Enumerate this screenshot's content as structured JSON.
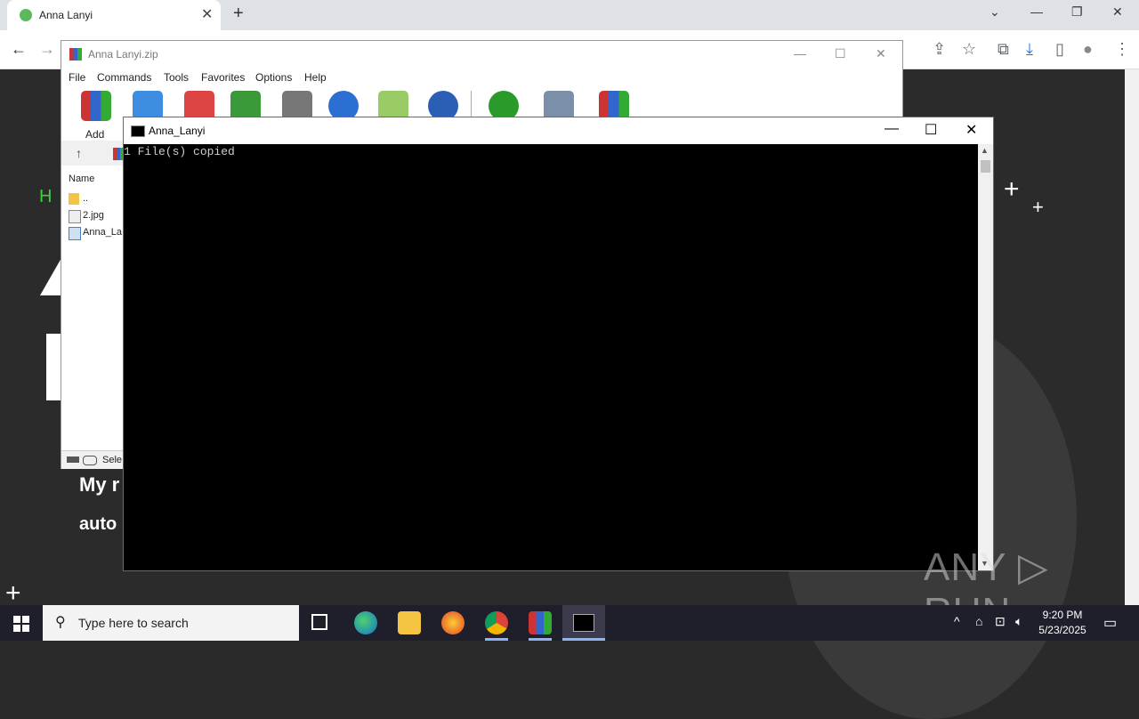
{
  "chrome": {
    "tab_title": "Anna Lanyi",
    "tab_close": "✕",
    "new_tab": "+",
    "window_controls": {
      "minimize": "—",
      "restore": "❐",
      "close": "✕"
    },
    "nav": {
      "back": "←",
      "forward": "→"
    },
    "toolbar_icons": {
      "share": "⇪",
      "star": "☆",
      "extensions": "⧉",
      "download": "⤓",
      "sidepanel": "▯",
      "profile": "●",
      "menu": "⋮"
    }
  },
  "webpage": {
    "greeting": "H I",
    "line1": "My r",
    "line2": "auto"
  },
  "winrar": {
    "title": "Anna Lanyi.zip",
    "window_controls": {
      "minimize": "—",
      "maximize": "☐",
      "close": "✕"
    },
    "menu": [
      "File",
      "Commands",
      "Tools",
      "Favorites",
      "Options",
      "Help"
    ],
    "add_label": "Add",
    "column_name": "Name",
    "files": [
      "..",
      "2.jpg",
      "Anna_La"
    ],
    "status_text": "Sele",
    "up_arrow": "↑"
  },
  "cmd": {
    "title": "Anna_Lanyi",
    "window_controls": {
      "minimize": "—",
      "maximize": "☐",
      "close": "✕"
    },
    "output": "1 File(s) copied",
    "scroll_up": "▲",
    "scroll_down": "▼"
  },
  "watermark": "ANY ▷ RUN",
  "taskbar": {
    "search_placeholder": "Type here to search",
    "time": "9:20 PM",
    "date": "5/23/2025",
    "tray": {
      "chevron": "^",
      "network": "⊡",
      "speaker": "🔈︎",
      "notifications": "▭"
    }
  },
  "colors": {
    "accent_green": "#3ad23a",
    "cmd_bg": "#000000",
    "taskbar": "#1f1f2b"
  }
}
